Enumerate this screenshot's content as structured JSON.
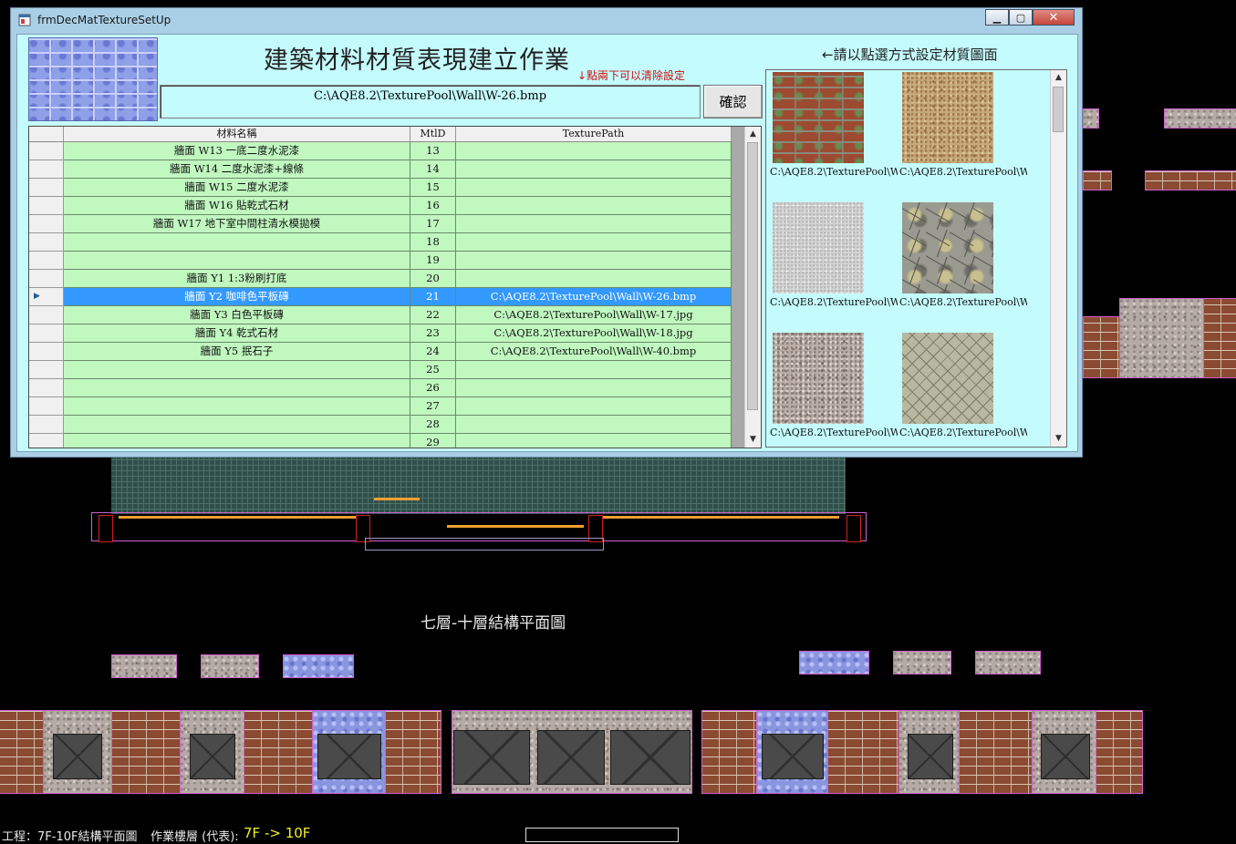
{
  "window": {
    "title": "frmDecMatTextureSetUp",
    "min_label": "▁",
    "max_label": "▢",
    "close_label": "✕"
  },
  "header": {
    "main_title": "建築材料材質表現建立作業",
    "clear_hint": "↓點兩下可以清除設定",
    "path_value": "C:\\AQE8.2\\TexturePool\\Wall\\W-26.bmp",
    "confirm_label": "確認",
    "texture_hint": "←請以點選方式設定材質圖面"
  },
  "grid": {
    "columns": [
      "",
      "材料名稱",
      "MtlD",
      "TexturePath"
    ],
    "rows": [
      {
        "name": "牆面 W13 一底二度水泥漆",
        "id": "13",
        "path": ""
      },
      {
        "name": "牆面 W14 二度水泥漆+線條",
        "id": "14",
        "path": ""
      },
      {
        "name": "牆面 W15 二度水泥漆",
        "id": "15",
        "path": ""
      },
      {
        "name": "牆面 W16 貼乾式石材",
        "id": "16",
        "path": ""
      },
      {
        "name": "牆面 W17 地下室中間柱清水模拋模",
        "id": "17",
        "path": ""
      },
      {
        "name": "",
        "id": "18",
        "path": ""
      },
      {
        "name": "",
        "id": "19",
        "path": ""
      },
      {
        "name": "牆面 Y1 1:3粉刷打底",
        "id": "20",
        "path": ""
      },
      {
        "name": "牆面 Y2 咖啡色平板磚",
        "id": "21",
        "path": "C:\\AQE8.2\\TexturePool\\Wall\\W-26.bmp",
        "selected": true
      },
      {
        "name": "牆面 Y3 白色平板磚",
        "id": "22",
        "path": "C:\\AQE8.2\\TexturePool\\Wall\\W-17.jpg"
      },
      {
        "name": "牆面 Y4 乾式石材",
        "id": "23",
        "path": "C:\\AQE8.2\\TexturePool\\Wall\\W-18.jpg"
      },
      {
        "name": "牆面 Y5 抿石子",
        "id": "24",
        "path": "C:\\AQE8.2\\TexturePool\\Wall\\W-40.bmp"
      },
      {
        "name": "",
        "id": "25",
        "path": ""
      },
      {
        "name": "",
        "id": "26",
        "path": ""
      },
      {
        "name": "",
        "id": "27",
        "path": ""
      },
      {
        "name": "",
        "id": "28",
        "path": ""
      },
      {
        "name": "",
        "id": "29",
        "path": ""
      }
    ]
  },
  "textures": [
    {
      "caption": "C:\\AQE8.2\\TexturePool\\W...",
      "icon": "brick-texture"
    },
    {
      "caption": "C:\\AQE8.2\\TexturePool\\W...",
      "icon": "sand-texture"
    },
    {
      "caption": "C:\\AQE8.2\\TexturePool\\W...",
      "icon": "plaster-texture"
    },
    {
      "caption": "C:\\AQE8.2\\TexturePool\\W...",
      "icon": "flagstone-texture"
    },
    {
      "caption": "C:\\AQE8.2\\TexturePool\\W...",
      "icon": "granite-texture"
    },
    {
      "caption": "C:\\AQE8.2\\TexturePool\\W...",
      "icon": "herringbone-texture"
    }
  ],
  "cad": {
    "plan_title": "七層-十層結構平面圖",
    "status_project": "工程：7F-10F結構平面圖",
    "status_floor_label": "作業樓層 (代表):",
    "status_floor_value": "7F -> 10F"
  },
  "colors": {
    "client_bg": "#c4fbfd",
    "row_bg": "#c0f8c0",
    "selection": "#3399ff",
    "hint_red": "#d01010"
  }
}
